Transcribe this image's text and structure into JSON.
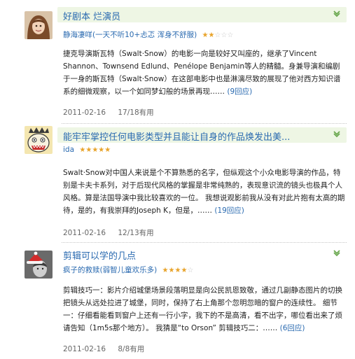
{
  "reviews": [
    {
      "title": "好剧本 烂演员",
      "author": "静海凄咩(一天不听10+忐忑 浑身不舒服)",
      "rating": 2,
      "body": "捷克导演斯瓦特（Swalt·Snow）的电影一向是较好又叫座的，继承了Vincent Shannon、Townsend Edlund、Penélope Benjamin等人的精髓。身兼导演和编剧于一身的斯瓦特（Swalt·Snow）在这部电影中也是淋漓尽致的展现了他对西方知识谱系的细微观察，以一个如同梦幻般的场景再现……",
      "reply": "(9回应)",
      "date": "2011-02-16",
      "useful": "17/18有用"
    },
    {
      "title": "能牢牢掌控任何电影类型并且能让自身的作品焕发出美...",
      "author": "ida",
      "rating": 5,
      "body": "Swalt·Snow对中国人来说是个不算熟悉的名字，但纵观这个小众电影导演的作品，特别是卡夫卡系列，对于后现代风格的掌握是非常纯熟的，表现意识流的镜头也极具个人风格。算是法国导演中我比较喜欢的一位。 我想说观影前我从没有对此片抱有太高的期待，是的，有我崇拜的Joseph K，但是，……",
      "reply": "(19回应)",
      "date": "2011-02-16",
      "useful": "12/13有用"
    },
    {
      "title": "剪辑可以学的几点",
      "author": "疯子的救赎(弱智儿童欢乐多)",
      "rating": 4,
      "body": "剪辑技巧一：影片介绍城堡场景段落明显是向公民凯恩致敬，通过几副静态图片的切换把镜头从远处拉进了城堡，同时，保持了右上角那个忽明忽暗的窗户的连续性。 细节一：仔细看能看到窗户上还有一行小字，我下的不是高清，看不出字，哪位看出来了烦请告知（1m5s那个地方）。 我猜是“to Orson” 剪辑技巧二：……",
      "reply": "(6回应)",
      "date": "2011-02-16",
      "useful": "8/8有用"
    }
  ],
  "colors": {
    "link": "#2a6ab0",
    "title_bar": "#eef6e4",
    "star_on": "#e8a32a",
    "star_off": "#c8c8c8",
    "chevron": "#6aa84f"
  }
}
